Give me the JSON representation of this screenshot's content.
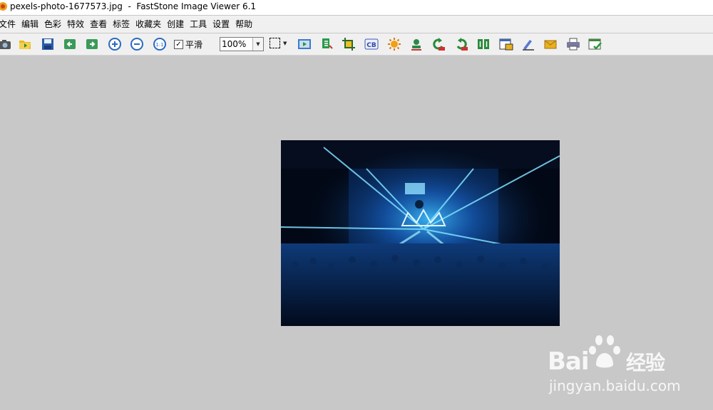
{
  "window": {
    "title": "pexels-photo-1677573.jpg  -  FastStone Image Viewer 6.1"
  },
  "menu": {
    "items": [
      "文件",
      "编辑",
      "色彩",
      "特效",
      "查看",
      "标签",
      "收藏夹",
      "创建",
      "工具",
      "设置",
      "帮助"
    ]
  },
  "toolbar": {
    "smooth_label": "平滑",
    "smooth_checked": true,
    "zoom_value": "100%",
    "icons": [
      "camera-icon",
      "open-folder-icon",
      "save-icon",
      "previous-icon",
      "next-icon",
      "zoom-in-icon",
      "zoom-out-icon",
      "actual-size-icon",
      "slideshow-icon",
      "resize-icon",
      "crop-icon",
      "color-adjust-icon",
      "sun-effect-icon",
      "stamp-icon",
      "rotate-left-icon",
      "rotate-right-icon",
      "compare-icon",
      "save-as-icon",
      "draw-icon",
      "email-icon",
      "print-icon",
      "settings-icon"
    ]
  },
  "watermark": {
    "brand_left": "Bai",
    "brand_right": "经验",
    "url": "jingyan.baidu.com"
  },
  "colors": {
    "background": "#c8c8c8",
    "toolbar": "#f0f0f0",
    "stage_blue": "#1a8fd8"
  }
}
